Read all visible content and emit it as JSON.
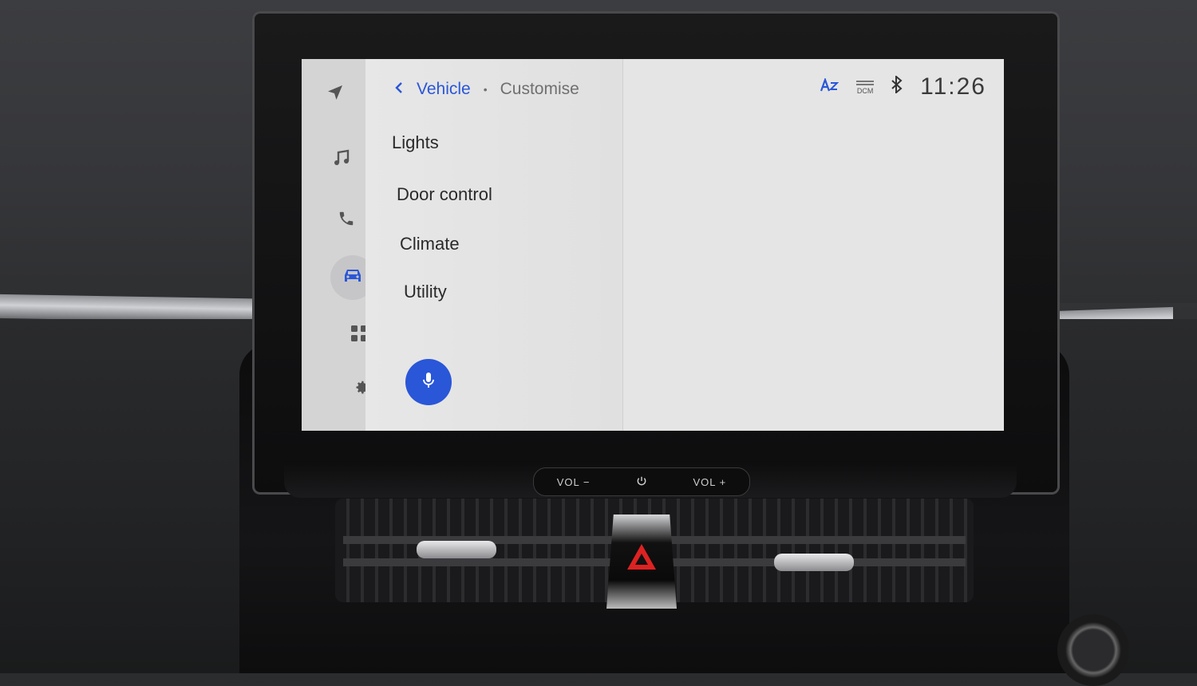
{
  "breadcrumb": {
    "parent": "Vehicle",
    "separator": "•",
    "current": "Customise"
  },
  "menu": {
    "items": [
      {
        "label": "Lights"
      },
      {
        "label": "Door control"
      },
      {
        "label": "Climate"
      },
      {
        "label": "Utility"
      }
    ]
  },
  "status_bar": {
    "clock": "11:26",
    "dcm_label": "DCM"
  },
  "hardware_buttons": {
    "vol_down": "VOL −",
    "vol_up": "VOL +"
  },
  "colors": {
    "accent": "#2a56d8",
    "text_primary": "#2a2a2a",
    "text_secondary": "#707070"
  },
  "icons": {
    "rail": [
      "navigation-icon",
      "music-icon",
      "phone-icon",
      "vehicle-icon",
      "apps-grid-icon",
      "settings-gear-icon"
    ],
    "status": [
      "voice-text-icon",
      "dcm-signal-icon",
      "bluetooth-icon"
    ]
  }
}
